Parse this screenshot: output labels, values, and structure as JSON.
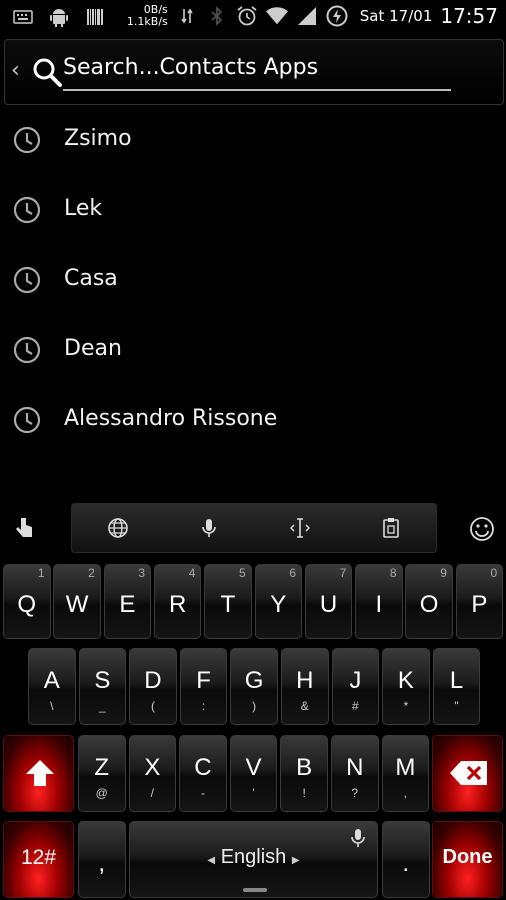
{
  "status": {
    "net_up": "0B/s",
    "net_down": "1.1kB/s",
    "date": "Sat 17/01",
    "time": "17:57",
    "icons": [
      "keyboard-icon",
      "android-icon",
      "barcode-icon",
      "data-transfer-icon",
      "bluetooth-icon",
      "alarm-icon",
      "wifi-icon",
      "signal-icon",
      "battery-charging-icon"
    ]
  },
  "search": {
    "text": "Search...Contacts Apps"
  },
  "contacts": [
    {
      "name": "Zsimo"
    },
    {
      "name": "Lek"
    },
    {
      "name": "Casa"
    },
    {
      "name": "Dean"
    },
    {
      "name": "Alessandro Rissone"
    }
  ],
  "keyboard": {
    "toolbar_icons": [
      "globe-icon",
      "microphone-icon",
      "cursor-icon",
      "clipboard-icon"
    ],
    "row1": [
      {
        "key": "Q",
        "num": "1"
      },
      {
        "key": "W",
        "num": "2"
      },
      {
        "key": "E",
        "num": "3"
      },
      {
        "key": "R",
        "num": "4"
      },
      {
        "key": "T",
        "num": "5"
      },
      {
        "key": "Y",
        "num": "6"
      },
      {
        "key": "U",
        "num": "7"
      },
      {
        "key": "I",
        "num": "8"
      },
      {
        "key": "O",
        "num": "9"
      },
      {
        "key": "P",
        "num": "0"
      }
    ],
    "row2": [
      {
        "key": "A",
        "alt": "\\"
      },
      {
        "key": "S",
        "alt": "_"
      },
      {
        "key": "D",
        "alt": "("
      },
      {
        "key": "F",
        "alt": ":"
      },
      {
        "key": "G",
        "alt": ")"
      },
      {
        "key": "H",
        "alt": "&"
      },
      {
        "key": "J",
        "alt": "#"
      },
      {
        "key": "K",
        "alt": "*"
      },
      {
        "key": "L",
        "alt": "\""
      }
    ],
    "row3": [
      {
        "key": "Z",
        "alt": "@"
      },
      {
        "key": "X",
        "alt": "/"
      },
      {
        "key": "C",
        "alt": "-"
      },
      {
        "key": "V",
        "alt": "'"
      },
      {
        "key": "B",
        "alt": "!"
      },
      {
        "key": "N",
        "alt": "?"
      },
      {
        "key": "M",
        "alt": ","
      }
    ],
    "symbols_label": "12#",
    "comma": ",",
    "space_label": "English",
    "period": ".",
    "done_label": "Done",
    "accent": "#e01010"
  }
}
